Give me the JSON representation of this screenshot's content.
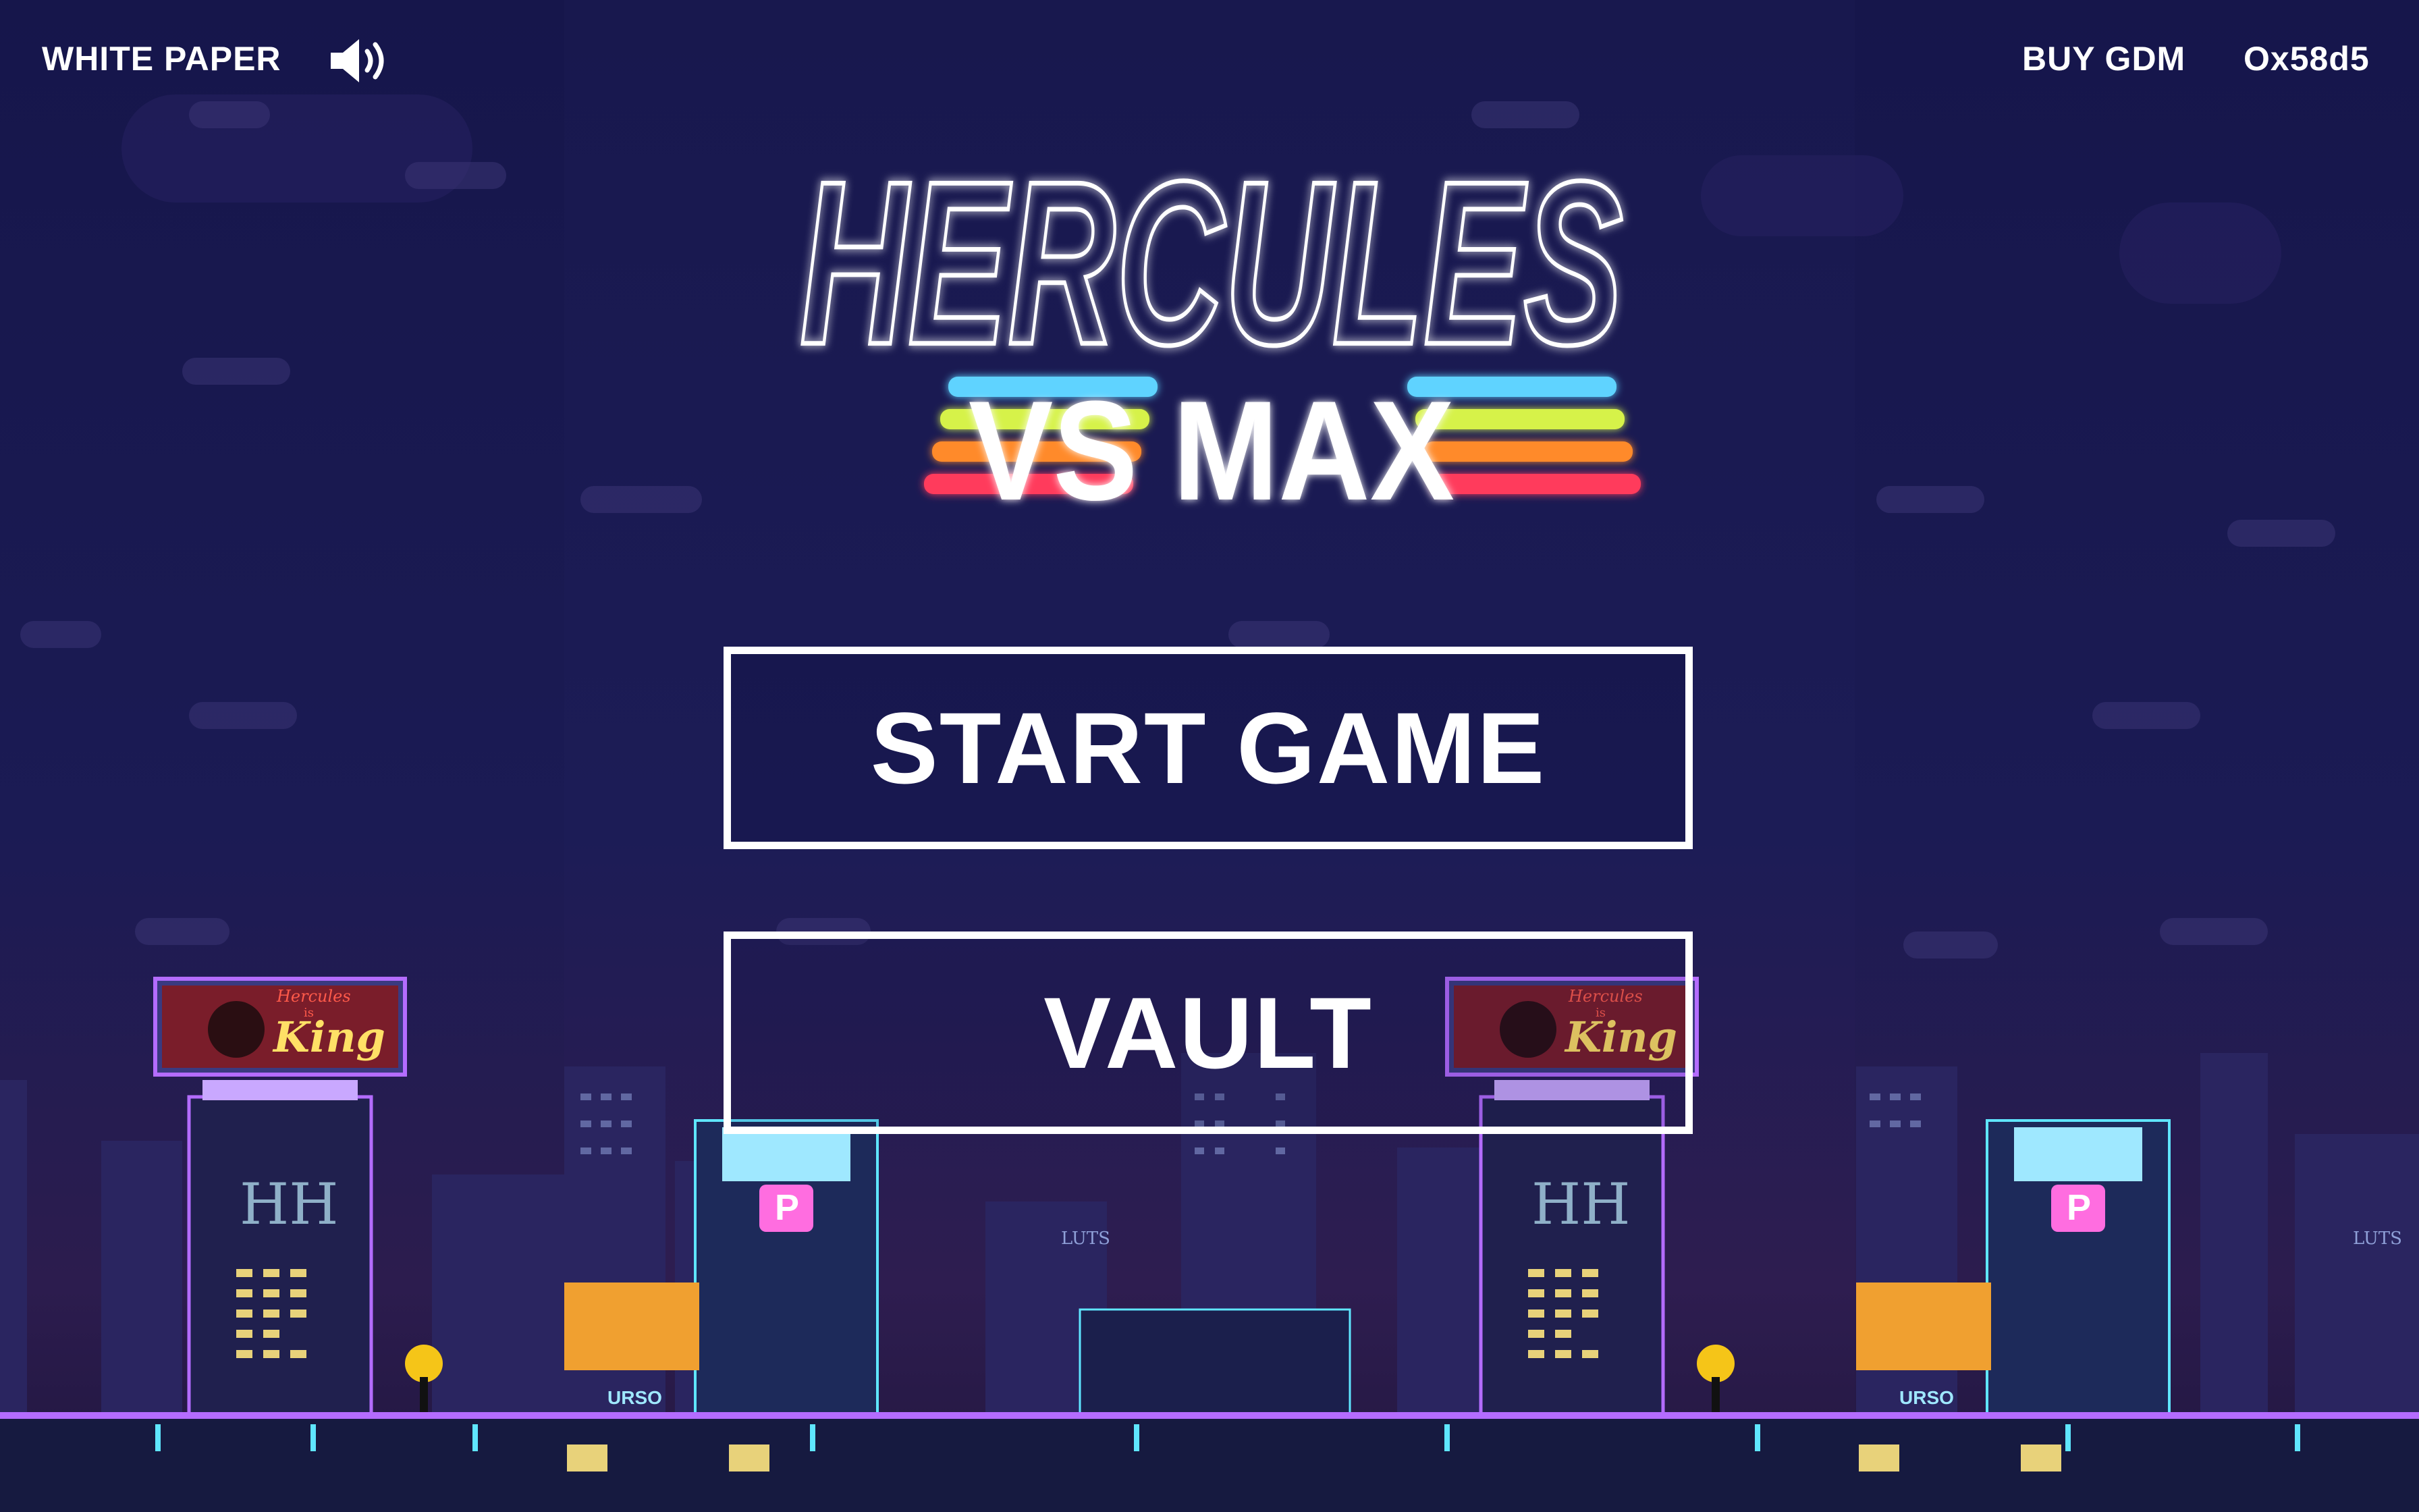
{
  "header": {
    "white_paper_label": "WHITE PAPER",
    "buy_label": "BUY GDM",
    "wallet_label": "Ox58d5",
    "sound_icon": "speaker-volume-icon"
  },
  "logo": {
    "line1": "HERCULES",
    "line2": "VS MAX",
    "stripe_colors": [
      "#5fd3ff",
      "#d6f24a",
      "#ff8a2a",
      "#ff3b5c"
    ]
  },
  "menu": {
    "start_label": "START GAME",
    "vault_label": "VAULT"
  },
  "scenery": {
    "billboard_line1": "Hercules",
    "billboard_line2": "is",
    "billboard_line3": "King",
    "tower_sign": "HH",
    "parking_sign": "P",
    "shop_sign": "LUTS",
    "neon_sign": "URSO"
  },
  "colors": {
    "sky": "#16164a",
    "neon_purple": "#b46cff",
    "neon_cyan": "#5fe6ff",
    "window_yellow": "#e8d27a"
  }
}
